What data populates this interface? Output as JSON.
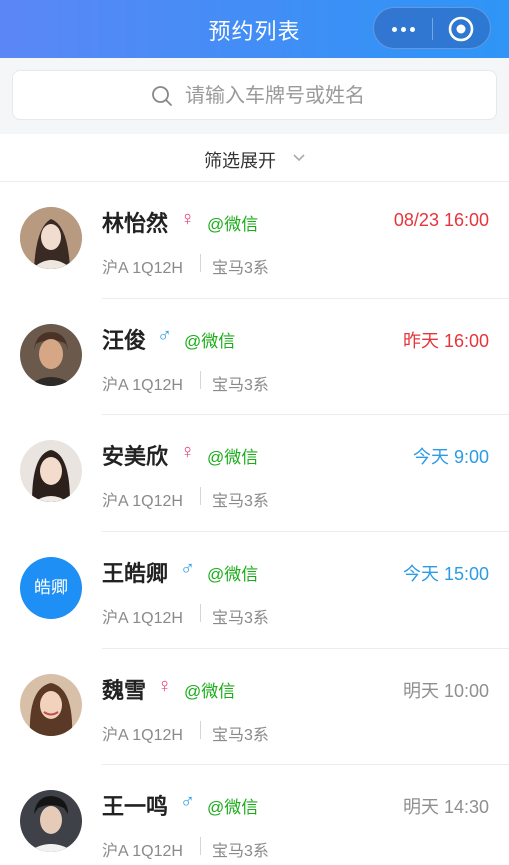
{
  "header": {
    "title": "预约列表"
  },
  "search": {
    "placeholder": "请输入车牌号或姓名"
  },
  "filter": {
    "label": "筛选展开"
  },
  "colors": {
    "header_start": "#5b87f6",
    "header_end": "#2f95f7",
    "wechat_green": "#1aad19",
    "red": "#e5353b",
    "blue": "#2c9be6",
    "gray": "#8f8f8f",
    "female": "#e8437a"
  },
  "items": [
    {
      "name": "林怡然",
      "gender_symbol": "♀",
      "gender": "female",
      "wechat": "@微信",
      "time": "08/23 16:00",
      "time_color": "red",
      "plate": "沪A 1Q12H",
      "car": "宝马3系",
      "avatar": "photo"
    },
    {
      "name": "汪俊",
      "gender_symbol": "♂",
      "gender": "male",
      "wechat": "@微信",
      "time": "昨天 16:00",
      "time_color": "red",
      "plate": "沪A 1Q12H",
      "car": "宝马3系",
      "avatar": "photo"
    },
    {
      "name": "安美欣",
      "gender_symbol": "♀",
      "gender": "female",
      "wechat": "@微信",
      "time": "今天 9:00",
      "time_color": "blue",
      "plate": "沪A 1Q12H",
      "car": "宝马3系",
      "avatar": "photo"
    },
    {
      "name": "王皓卿",
      "gender_symbol": "♂",
      "gender": "male",
      "wechat": "@微信",
      "time": "今天 15:00",
      "time_color": "blue",
      "plate": "沪A 1Q12H",
      "car": "宝马3系",
      "avatar": "text",
      "avatar_text": "皓卿"
    },
    {
      "name": "魏雪",
      "gender_symbol": "♀",
      "gender": "female",
      "wechat": "@微信",
      "time": "明天 10:00",
      "time_color": "gray",
      "plate": "沪A 1Q12H",
      "car": "宝马3系",
      "avatar": "photo"
    },
    {
      "name": "王一鸣",
      "gender_symbol": "♂",
      "gender": "male",
      "wechat": "@微信",
      "time": "明天 14:30",
      "time_color": "gray",
      "plate": "沪A 1Q12H",
      "car": "宝马3系",
      "avatar": "photo"
    }
  ]
}
